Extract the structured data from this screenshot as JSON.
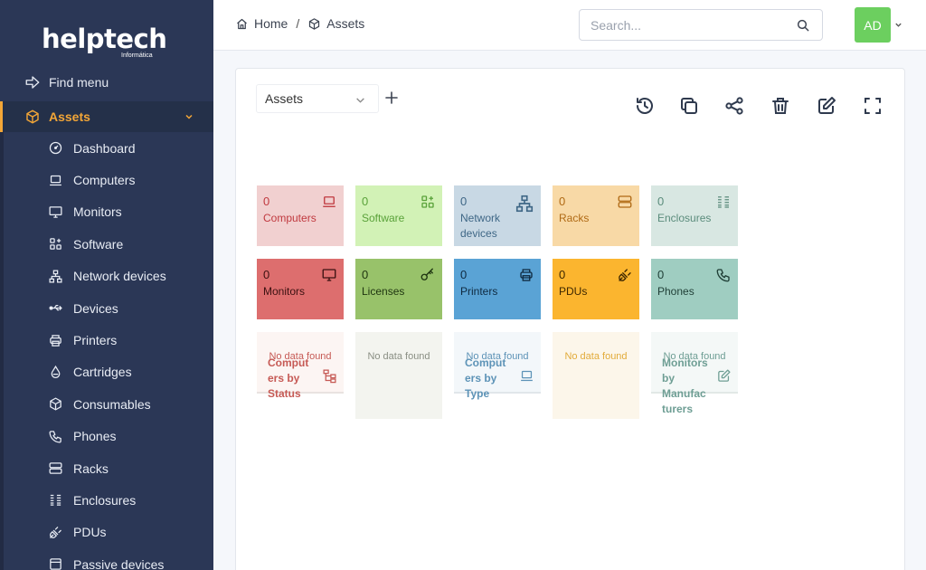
{
  "app": {
    "logo_main": "helptech",
    "logo_sub": "Informática"
  },
  "sidebar": {
    "find_menu": "Find menu",
    "section": "Assets",
    "items": [
      {
        "label": "Dashboard",
        "icon": "gauge-icon"
      },
      {
        "label": "Computers",
        "icon": "laptop-icon"
      },
      {
        "label": "Monitors",
        "icon": "monitor-icon"
      },
      {
        "label": "Software",
        "icon": "apps-icon"
      },
      {
        "label": "Network devices",
        "icon": "network-icon"
      },
      {
        "label": "Devices",
        "icon": "usb-icon"
      },
      {
        "label": "Printers",
        "icon": "printer-icon"
      },
      {
        "label": "Cartridges",
        "icon": "droplet-icon"
      },
      {
        "label": "Consumables",
        "icon": "box-icon"
      },
      {
        "label": "Phones",
        "icon": "phone-icon"
      },
      {
        "label": "Racks",
        "icon": "server-icon"
      },
      {
        "label": "Enclosures",
        "icon": "columns-icon"
      },
      {
        "label": "PDUs",
        "icon": "plug-icon"
      },
      {
        "label": "Passive devices",
        "icon": "device-icon"
      }
    ]
  },
  "header": {
    "breadcrumb_home": "Home",
    "breadcrumb_sep": "/",
    "breadcrumb_current": "Assets",
    "search_placeholder": "Search...",
    "avatar_initials": "AD"
  },
  "dashboard": {
    "selected": "Assets",
    "tiles_row1": [
      {
        "count": "0",
        "label": "Computers",
        "icon": "laptop-icon",
        "bg": "#f1d0d0",
        "fg": "#c0393f"
      },
      {
        "count": "0",
        "label": "Software",
        "icon": "apps-icon",
        "bg": "#d2f2b6",
        "fg": "#5aa23a"
      },
      {
        "count": "0",
        "label": "Network devices",
        "icon": "network-icon",
        "bg": "#c8d8e4",
        "fg": "#3f6786"
      },
      {
        "count": "0",
        "label": "Racks",
        "icon": "server-icon",
        "bg": "#f8d9a6",
        "fg": "#b06a15"
      },
      {
        "count": "0",
        "label": "Enclosures",
        "icon": "columns-icon",
        "bg": "#d8e7e2",
        "fg": "#5b8c7c"
      }
    ],
    "tiles_row2": [
      {
        "count": "0",
        "label": "Monitors",
        "icon": "monitor-icon",
        "bg": "#dd6e6e",
        "fg": "#3b1111"
      },
      {
        "count": "0",
        "label": "Licenses",
        "icon": "key-icon",
        "bg": "#98c26a",
        "fg": "#1e3410"
      },
      {
        "count": "0",
        "label": "Printers",
        "icon": "printer-icon",
        "bg": "#5aa3d5",
        "fg": "#0f2a40"
      },
      {
        "count": "0",
        "label": "PDUs",
        "icon": "plug-icon",
        "bg": "#fbb52f",
        "fg": "#3d2700"
      },
      {
        "count": "0",
        "label": "Phones",
        "icon": "phone-icon",
        "bg": "#9fcdc1",
        "fg": "#1f3e36"
      }
    ],
    "empty_cards": [
      {
        "message": "No data found",
        "title": "Computers by Status",
        "title_lines": [
          "Comput",
          "ers by",
          "Status"
        ],
        "icon": "hierarchy-icon",
        "bg": "#fcf5f3",
        "fg": "#c65a55"
      },
      {
        "message": "No data found",
        "title": "",
        "title_lines": [],
        "icon": "",
        "bg": "#f3f4ef",
        "fg": "#8a8f84"
      },
      {
        "message": "No data found",
        "title": "Computers by Type",
        "title_lines": [
          "Comput",
          "ers by",
          "Type"
        ],
        "icon": "laptop-icon",
        "bg": "#f3f7fa",
        "fg": "#5d93b7"
      },
      {
        "message": "No data found",
        "title": "",
        "title_lines": [],
        "icon": "",
        "bg": "#fcf6ea",
        "fg": "#e2ab3a"
      },
      {
        "message": "No data found",
        "title": "Monitors by Manufacturers",
        "title_lines": [
          "Monitors",
          "by",
          "Manufac",
          "turers"
        ],
        "icon": "edit-icon",
        "bg": "#f4f8f7",
        "fg": "#6e9e94"
      }
    ]
  }
}
